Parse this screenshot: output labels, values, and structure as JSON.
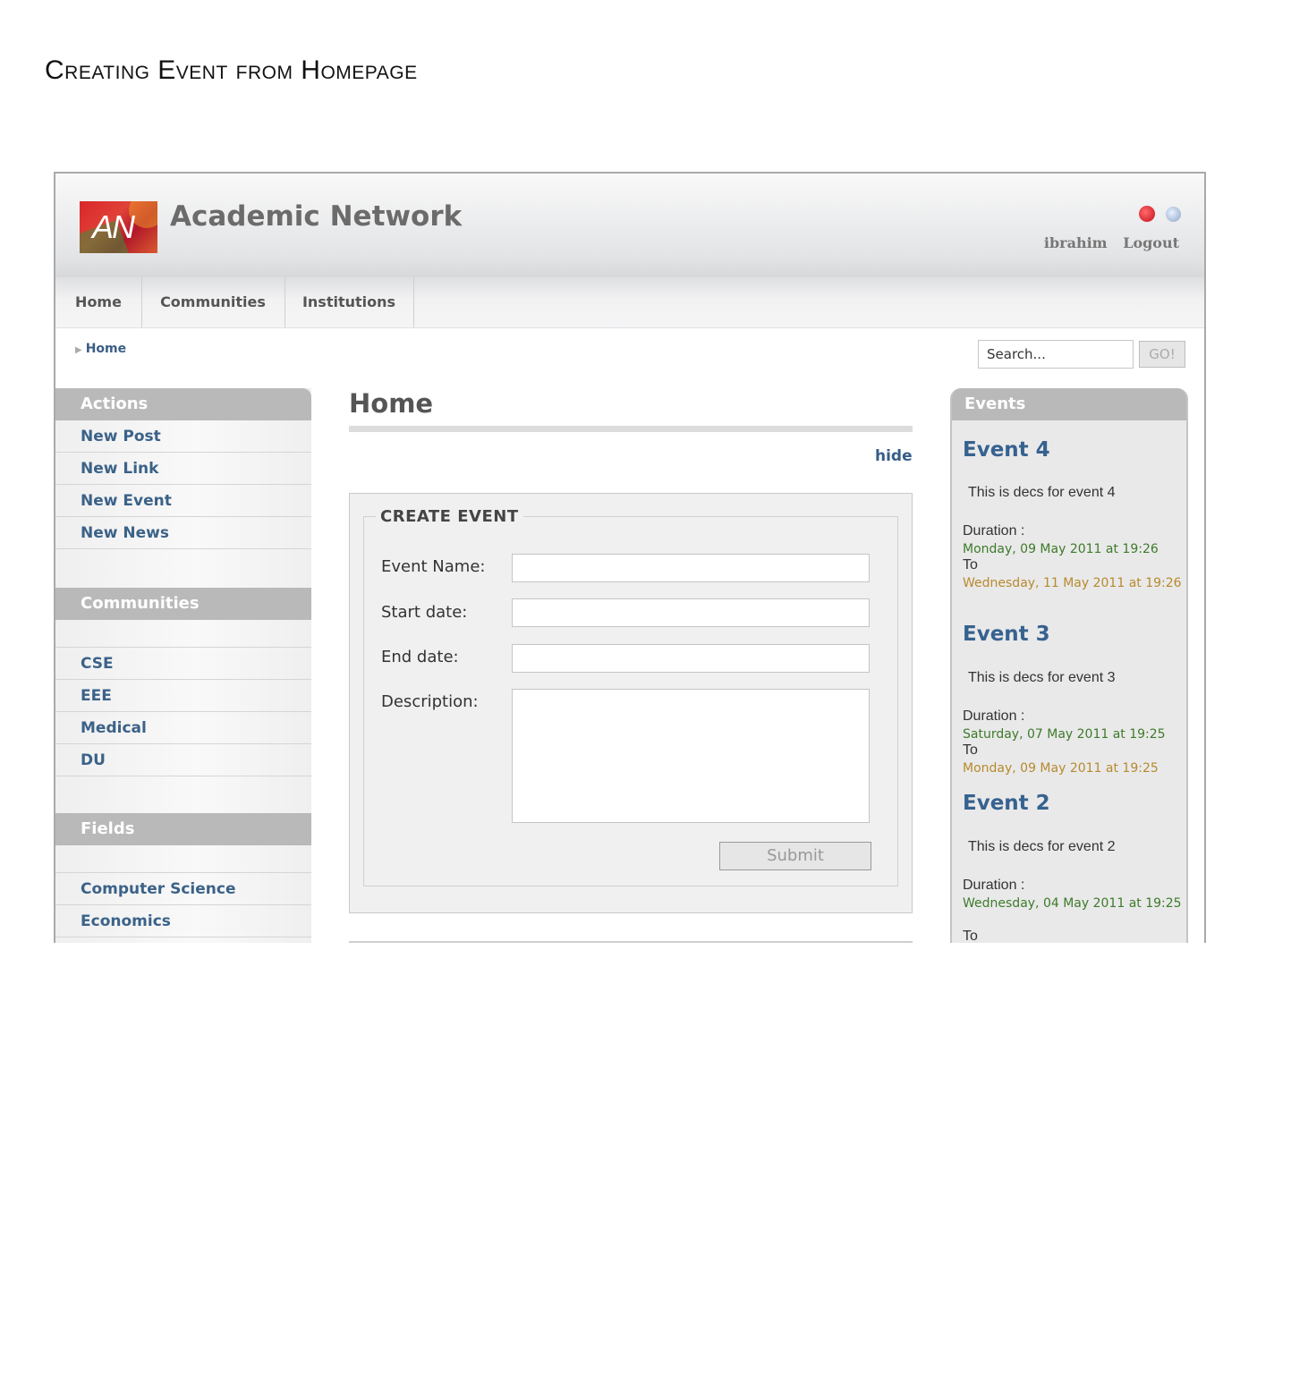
{
  "doc_title": "Creating Event from Homepage",
  "header": {
    "logo_text": "AN",
    "site_title": "Academic Network",
    "icons": [
      "help-icon",
      "globe-icon"
    ],
    "username": "ibrahim",
    "logout": "Logout"
  },
  "nav": [
    "Home",
    "Communities",
    "Institutions"
  ],
  "breadcrumb": "Home",
  "search": {
    "placeholder": "Search...",
    "value": "Search...",
    "go": "GO!"
  },
  "sidebar": {
    "actions": {
      "title": "Actions",
      "items": [
        "New Post",
        "New Link",
        "New Event",
        "New News"
      ]
    },
    "communities": {
      "title": "Communities",
      "items": [
        "CSE",
        "EEE",
        "Medical",
        "DU"
      ]
    },
    "fields": {
      "title": "Fields",
      "items": [
        "Computer Science",
        "Economics"
      ]
    }
  },
  "main": {
    "heading": "Home",
    "hide": "hide",
    "form": {
      "legend": "CREATE EVENT",
      "event_name_label": "Event Name:",
      "start_date_label": "Start date:",
      "end_date_label": "End date:",
      "description_label": "Description:",
      "submit": "Submit"
    }
  },
  "events": {
    "title": "Events",
    "duration_label": "Duration :",
    "to_label": "To",
    "items": [
      {
        "name": "Event 4",
        "desc": "This is decs for event 4",
        "start": "Monday, 09 May 2011 at 19:26",
        "end": "Wednesday, 11 May 2011 at 19:26"
      },
      {
        "name": "Event 3",
        "desc": "This is decs for event 3",
        "start": "Saturday, 07 May 2011 at 19:25",
        "end": "Monday, 09 May 2011 at 19:25"
      },
      {
        "name": "Event 2",
        "desc": "This is decs for event 2",
        "start": "Wednesday, 04 May 2011 at 19:25",
        "end": ""
      }
    ]
  }
}
